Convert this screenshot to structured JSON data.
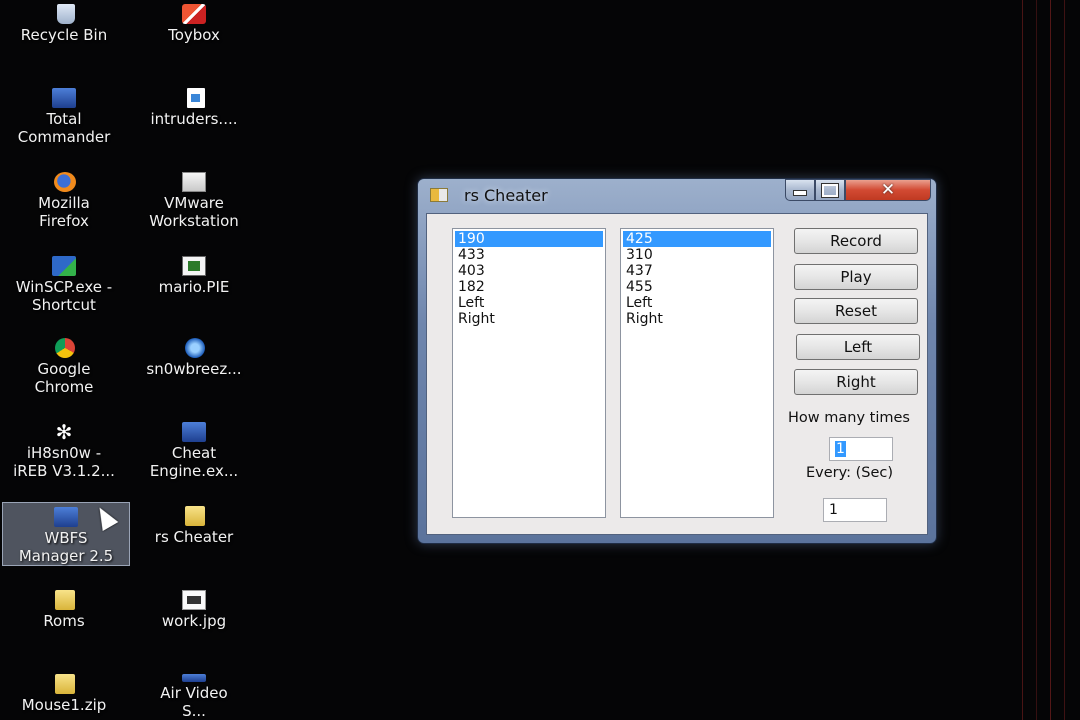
{
  "desktop": {
    "icons": [
      {
        "label": "Recycle Bin",
        "icon": "recycle-bin-icon"
      },
      {
        "label": "Toybox",
        "icon": "toybox-icon"
      },
      {
        "label": "Total\nCommander",
        "icon": "total-commander-icon"
      },
      {
        "label": "intruders....",
        "icon": "document-icon"
      },
      {
        "label": "Mozilla\nFirefox",
        "icon": "firefox-icon"
      },
      {
        "label": "VMware\nWorkstation",
        "icon": "vmware-icon"
      },
      {
        "label": "WinSCP.exe -\nShortcut",
        "icon": "winscp-icon"
      },
      {
        "label": "mario.PIE",
        "icon": "pie-file-icon"
      },
      {
        "label": "Google\nChrome",
        "icon": "chrome-icon"
      },
      {
        "label": "sn0wbreez...",
        "icon": "globe-icon"
      },
      {
        "label": "iH8sn0w -\niREB V3.1.2...",
        "icon": "snowflake-icon"
      },
      {
        "label": "Cheat\nEngine.ex...",
        "icon": "cheat-engine-icon"
      },
      {
        "label": "WBFS\nManager 2.5",
        "icon": "wbfs-icon"
      },
      {
        "label": "rs Cheater",
        "icon": "rs-cheater-icon"
      },
      {
        "label": "Roms",
        "icon": "folder-icon"
      },
      {
        "label": "work.jpg",
        "icon": "image-file-icon"
      },
      {
        "label": "Mouse1.zip",
        "icon": "zip-icon"
      },
      {
        "label": "Air Video\nS...",
        "icon": "air-video-icon"
      }
    ]
  },
  "window": {
    "title": "rs Cheater",
    "caption_close": "✕",
    "list_left": [
      "190",
      "433",
      "403",
      "182",
      "Left",
      "Right"
    ],
    "list_right": [
      "425",
      "310",
      "437",
      "455",
      "Left",
      "Right"
    ],
    "selected_index": 0,
    "buttons": {
      "record": "Record",
      "play": "Play",
      "reset": "Reset",
      "left": "Left",
      "right": "Right"
    },
    "how_many_label": "How many times",
    "how_many_value": "1",
    "every_label": "Every: (Sec)",
    "every_value": "1"
  }
}
